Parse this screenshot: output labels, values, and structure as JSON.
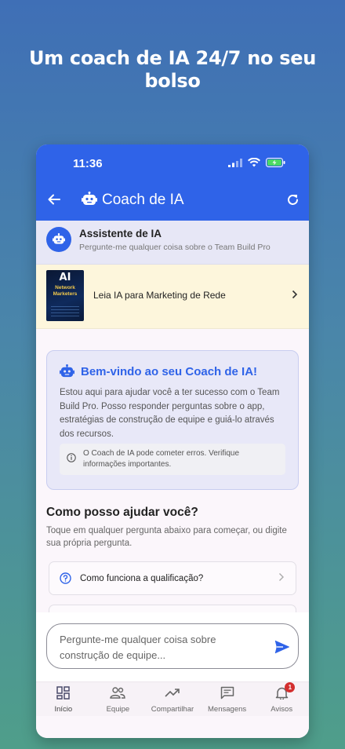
{
  "headline": "Um coach de IA 24/7 no seu bolso",
  "status_bar": {
    "time": "11:36"
  },
  "toolbar": {
    "title": "Coach de IA"
  },
  "assistant": {
    "title": "Assistente de IA",
    "subtitle": "Pergunte-me qualquer coisa sobre o Team Build Pro"
  },
  "book_banner": {
    "cover_title": "AI",
    "cover_subtitle_1": "Network",
    "cover_subtitle_2": "Marketers",
    "label": "Leia IA para Marketing de Rede"
  },
  "welcome": {
    "title": "Bem-vindo ao seu Coach de IA!",
    "text": "Estou aqui para ajudar você a ter sucesso com o Team Build Pro. Posso responder perguntas sobre o app, estratégias de construção de equipe e guiá-lo através dos recursos.",
    "disclaimer": "O Coach de IA pode cometer erros. Verifique informações importantes."
  },
  "help": {
    "title": "Como posso ajudar você?",
    "subtitle": "Toque em qualquer pergunta abaixo para começar, ou digite sua própria pergunta.",
    "questions": [
      {
        "label": "Como funciona a qualificação?"
      }
    ]
  },
  "composer": {
    "placeholder": "Pergunte-me qualquer coisa sobre construção de equipe..."
  },
  "bottom_nav": {
    "items": [
      {
        "label": "Início",
        "icon": "dashboard-icon"
      },
      {
        "label": "Equipe",
        "icon": "group-icon"
      },
      {
        "label": "Compartilhar",
        "icon": "trending-up-icon"
      },
      {
        "label": "Mensagens",
        "icon": "message-icon"
      },
      {
        "label": "Avisos",
        "icon": "bell-icon",
        "badge": "1"
      }
    ]
  },
  "colors": {
    "primary": "#2f63e8",
    "badge": "#d32f2f",
    "banner": "#fdf6dc"
  }
}
